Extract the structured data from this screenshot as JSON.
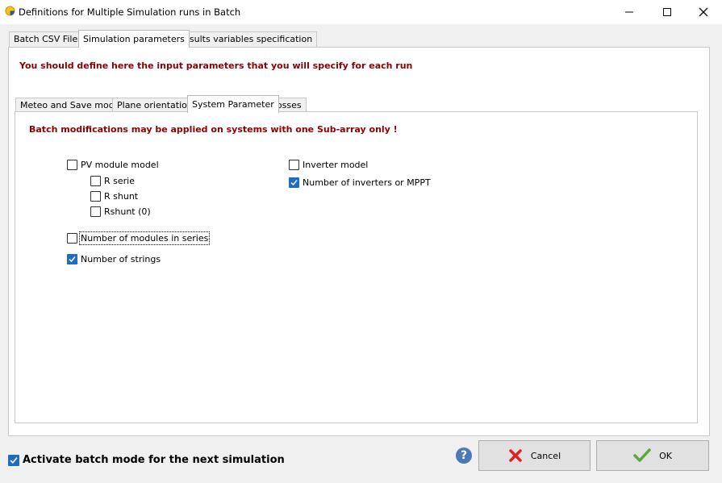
{
  "window": {
    "title": "Definitions for Multiple Simulation runs in Batch",
    "app_icon": "pvsyst-sun-icon"
  },
  "main_tabs": [
    {
      "label": "Batch CSV Files",
      "active": false
    },
    {
      "label": "Simulation parameters",
      "active": true
    },
    {
      "label": "Results variables specification",
      "active": false
    }
  ],
  "main_notice": "You should define here the input parameters that you will specify for each run",
  "sub_tabs": [
    {
      "label": "Meteo and Save mode",
      "active": false
    },
    {
      "label": "Plane orientation",
      "active": false
    },
    {
      "label": "System Parameter",
      "active": true
    },
    {
      "label": "Losses",
      "active": false
    }
  ],
  "system_notice": "Batch modifications may be applied on systems with one Sub-array only !",
  "left_options": {
    "pv_module_model": {
      "label": "PV module model",
      "checked": false
    },
    "r_serie": {
      "label": "R serie",
      "checked": false
    },
    "r_shunt": {
      "label": "R shunt",
      "checked": false
    },
    "rshunt_0": {
      "label": "Rshunt (0)",
      "checked": false
    },
    "modules_in_series": {
      "label": "Number of modules in series",
      "checked": false
    },
    "strings": {
      "label": "Number of strings",
      "checked": true
    }
  },
  "right_options": {
    "inverter_model": {
      "label": "Inverter model",
      "checked": false
    },
    "inverters_mppt": {
      "label": "Number of inverters or MPPT",
      "checked": true
    }
  },
  "footer": {
    "batch_mode_label": "Activate batch mode for the next simulation",
    "batch_mode_checked": true,
    "help_glyph": "?",
    "cancel_label": "Cancel",
    "ok_label": "OK"
  },
  "colors": {
    "notice": "#8b0000",
    "checkbox_checked": "#1e6cc4",
    "cancel_icon": "#e02020",
    "ok_icon": "#5aa83a"
  }
}
